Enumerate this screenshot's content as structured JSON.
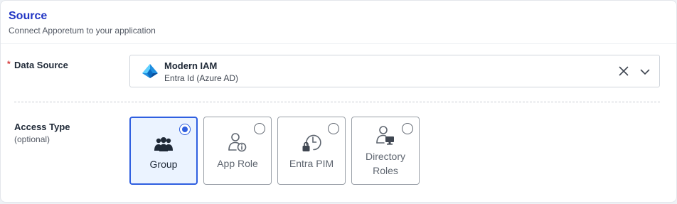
{
  "header": {
    "title": "Source",
    "subtitle": "Connect Apporetum to your application"
  },
  "data_source": {
    "required_marker": "*",
    "label": "Data Source",
    "selected_name": "Modern IAM",
    "selected_sub": "Entra Id (Azure AD)",
    "logo_icon": "azure-entra-logo-icon",
    "clear_icon": "close-icon",
    "expand_icon": "chevron-down-icon"
  },
  "access_type": {
    "label": "Access Type",
    "hint": "(optional)",
    "options": [
      {
        "label": "Group",
        "icon": "users-group-icon",
        "selected": true
      },
      {
        "label": "App Role",
        "icon": "user-info-icon",
        "selected": false
      },
      {
        "label": "Entra PIM",
        "icon": "clock-lock-icon",
        "selected": false
      },
      {
        "label": "Directory Roles",
        "label_line1": "Directory",
        "label_line2": "Roles",
        "icon": "user-monitor-icon",
        "selected": false
      }
    ]
  },
  "colors": {
    "accent": "#2f5fe0",
    "title": "#2236c4",
    "required": "#d63b3b",
    "selected_bg": "#ebf3ff"
  }
}
